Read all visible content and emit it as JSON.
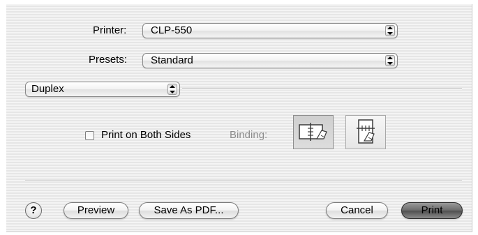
{
  "printer": {
    "label": "Printer:",
    "value": "CLP-550"
  },
  "presets": {
    "label": "Presets:",
    "value": "Standard"
  },
  "section": {
    "value": "Duplex"
  },
  "duplex": {
    "checkbox_label": "Print on Both Sides",
    "checked": false,
    "binding_label": "Binding:",
    "binding_options": [
      "long-edge",
      "short-edge"
    ],
    "selected_binding": "long-edge"
  },
  "buttons": {
    "help": "?",
    "preview": "Preview",
    "save_pdf": "Save As PDF...",
    "cancel": "Cancel",
    "print": "Print"
  },
  "colors": {
    "background": "#ececec",
    "disabled_text": "#8c8c8c",
    "default_button": "#6c6c6c"
  }
}
